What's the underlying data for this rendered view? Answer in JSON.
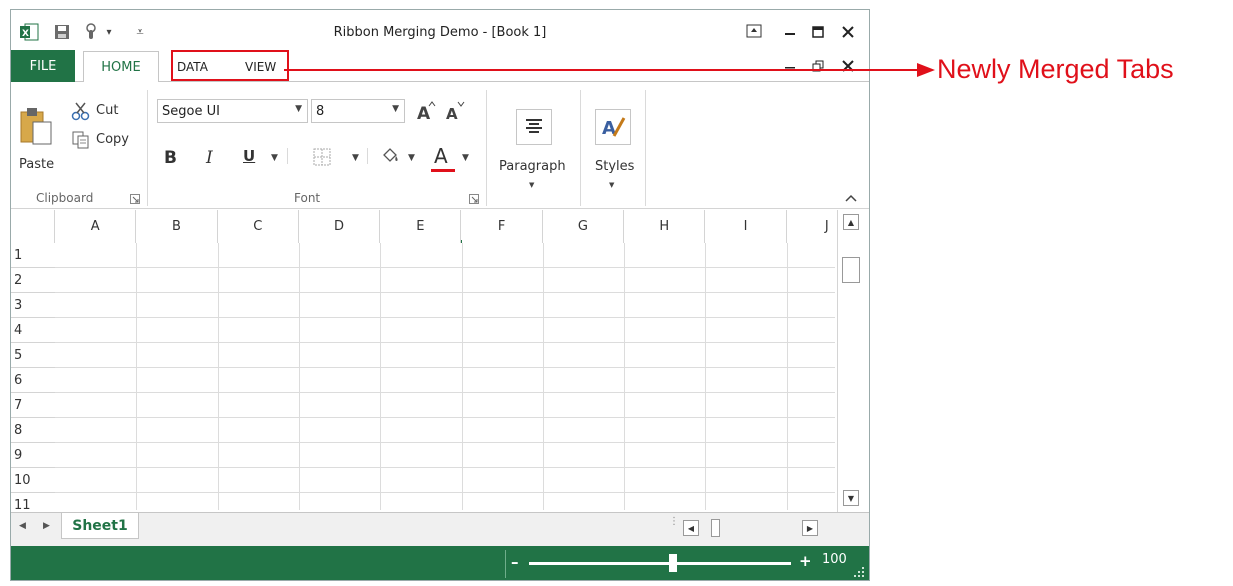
{
  "window": {
    "title": "Ribbon Merging Demo - [Book 1]",
    "qat_dropdown": "▾",
    "qat_customize": "⩡"
  },
  "tabs": {
    "file": "FILE",
    "home": "HOME",
    "data": "DATA",
    "view": "VIEW"
  },
  "clipboard": {
    "paste": "Paste",
    "cut": "Cut",
    "copy": "Copy",
    "label": "Clipboard"
  },
  "font": {
    "name": "Segoe UI",
    "size": "8",
    "bold": "B",
    "italic": "I",
    "underline": "U",
    "color_letter": "A",
    "color_accent": "#e0101a",
    "label": "Font"
  },
  "paragraph": {
    "label": "Paragraph"
  },
  "styles": {
    "label": "Styles"
  },
  "grid": {
    "columns": [
      "A",
      "B",
      "C",
      "D",
      "E",
      "F",
      "G",
      "H",
      "I",
      "J"
    ],
    "rows": [
      "1",
      "2",
      "3",
      "4",
      "5",
      "6",
      "7",
      "8",
      "9",
      "10",
      "11"
    ]
  },
  "sheet": {
    "tab": "Sheet1"
  },
  "zoom": {
    "minus": "–",
    "plus": "+",
    "value": "100",
    "level": 0.55
  },
  "annotation": {
    "text": "Newly Merged Tabs"
  },
  "colors": {
    "brand_green": "#217346",
    "annotation_red": "#e0101a"
  }
}
